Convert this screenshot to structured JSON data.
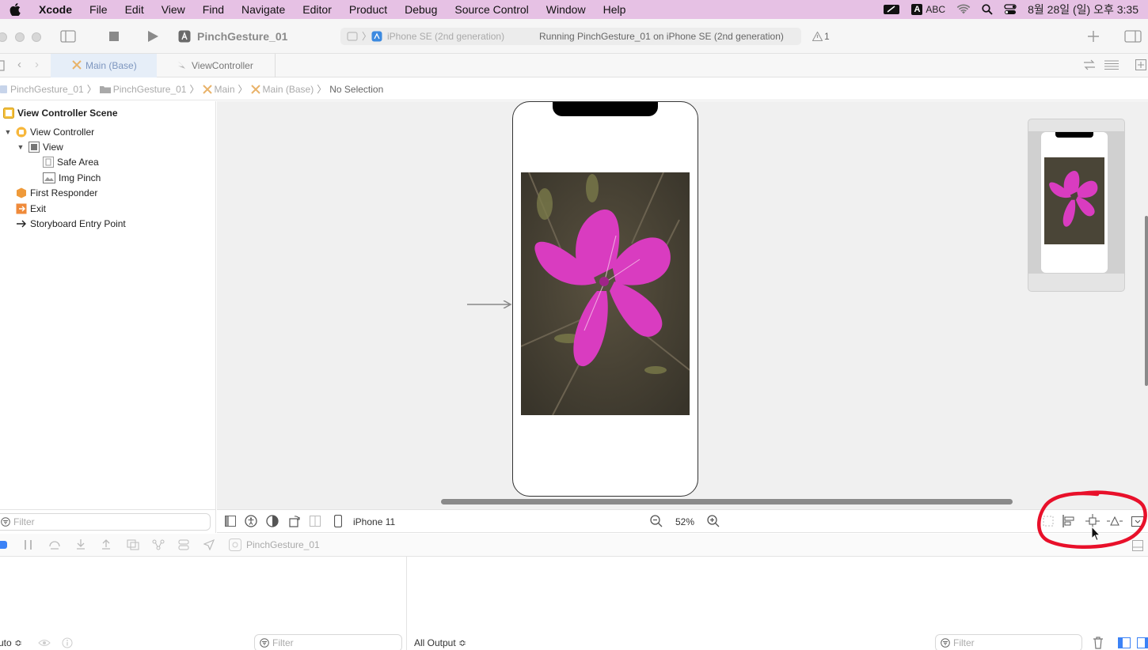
{
  "menubar": {
    "app": "Xcode",
    "items": [
      "File",
      "Edit",
      "View",
      "Find",
      "Navigate",
      "Editor",
      "Product",
      "Debug",
      "Source Control",
      "Window",
      "Help"
    ],
    "input_badge": "A",
    "input_label": "ABC",
    "datetime": "8월 28일 (일) 오후 3:35"
  },
  "toolbar": {
    "project_title": "PinchGesture_01",
    "scheme_device": "iPhone SE (2nd generation)",
    "status": "Running PinchGesture_01 on iPhone SE (2nd generation)",
    "warning_count": "1"
  },
  "tabs": [
    {
      "label": "Main (Base)",
      "active": true
    },
    {
      "label": "ViewController",
      "active": false
    }
  ],
  "breadcrumb": [
    "PinchGesture_01",
    "PinchGesture_01",
    "Main",
    "Main (Base)",
    "No Selection"
  ],
  "outline": {
    "scene": "View Controller Scene",
    "items": [
      {
        "label": "View Controller"
      },
      {
        "label": "View"
      },
      {
        "label": "Safe Area"
      },
      {
        "label": "Img Pinch"
      },
      {
        "label": "First Responder"
      },
      {
        "label": "Exit"
      },
      {
        "label": "Storyboard Entry Point"
      }
    ]
  },
  "canvas_bar": {
    "device": "iPhone 11",
    "zoom": "52%"
  },
  "filter_placeholder": "Filter",
  "debug": {
    "target": "PinchGesture_01",
    "auto_label": "uto ≎",
    "output_label": "All Output ≎"
  },
  "colors": {
    "menubar_bg": "#e6c1e4",
    "annotation_red": "#e8102a",
    "flower": "#d93cc0"
  }
}
